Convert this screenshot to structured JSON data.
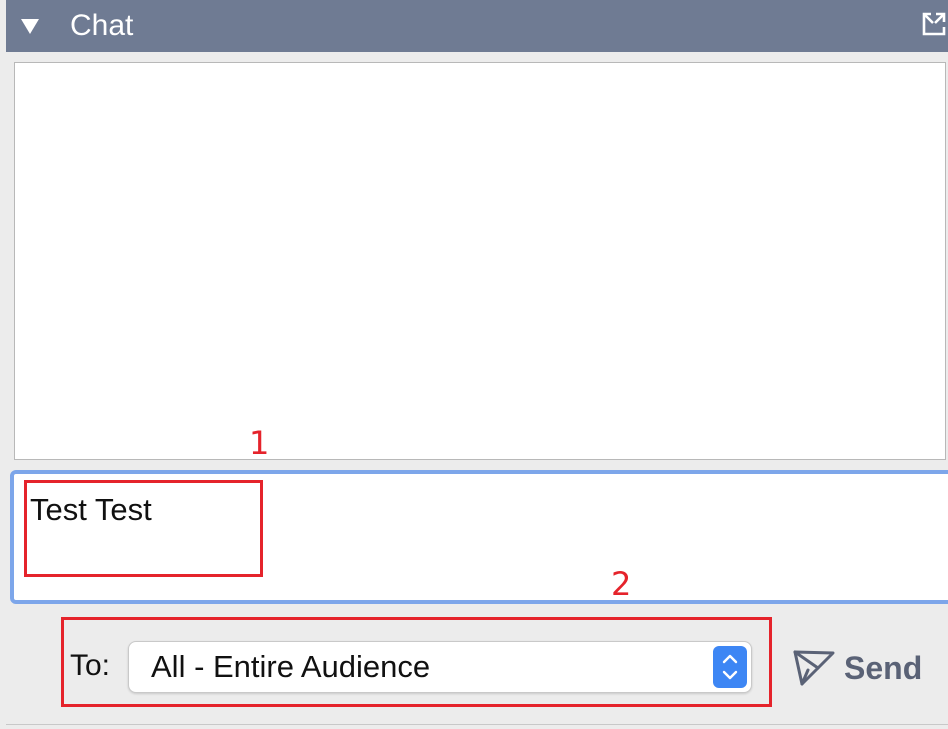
{
  "header": {
    "title": "Chat",
    "collapse_icon": "triangle-down-icon",
    "popout_icon": "popout-window-icon",
    "background": "#6f7b93"
  },
  "compose": {
    "value": "Test Test",
    "focus_color": "#7da6ea"
  },
  "recipient": {
    "label": "To:",
    "selected": "All - Entire Audience",
    "control_icon": "chevron-up-down-icon",
    "accent": "#3d86f4"
  },
  "send": {
    "label": "Send",
    "icon": "paper-plane-icon"
  },
  "annotations": [
    {
      "number": "1",
      "color": "#e5232b"
    },
    {
      "number": "2",
      "color": "#e5232b"
    }
  ]
}
